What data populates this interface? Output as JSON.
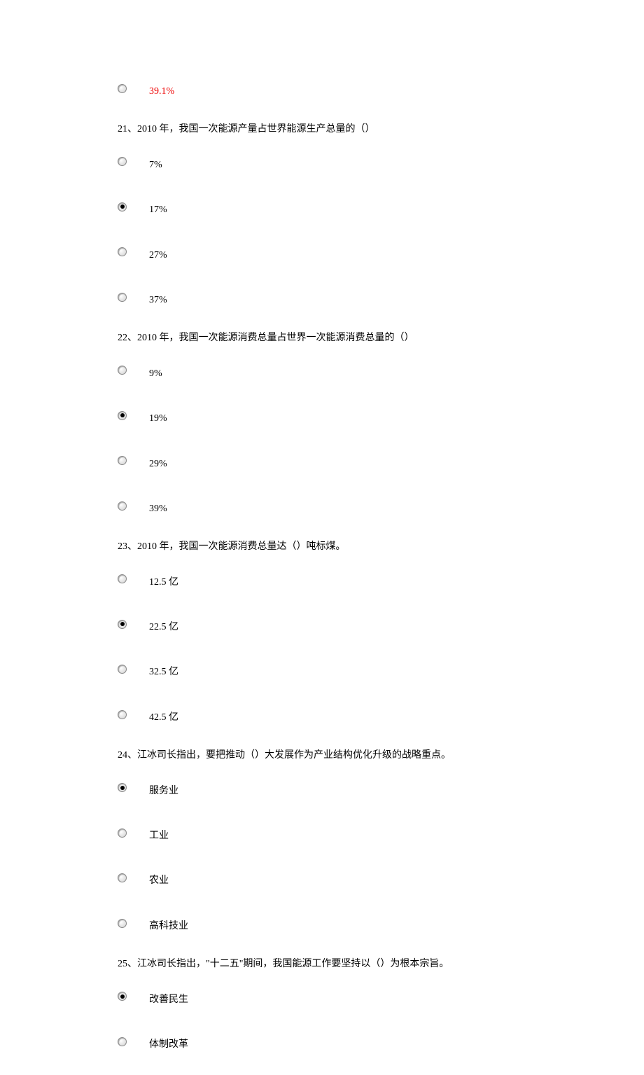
{
  "top_option": {
    "text": "39.1%",
    "highlight": true,
    "selected": false
  },
  "questions": [
    {
      "number": "21",
      "text": "21、2010 年，我国一次能源产量占世界能源生产总量的（）",
      "options": [
        {
          "text": "7%",
          "selected": false
        },
        {
          "text": "17%",
          "selected": true
        },
        {
          "text": "27%",
          "selected": false
        },
        {
          "text": "37%",
          "selected": false
        }
      ]
    },
    {
      "number": "22",
      "text": "22、2010 年，我国一次能源消费总量占世界一次能源消费总量的（）",
      "options": [
        {
          "text": "9%",
          "selected": false
        },
        {
          "text": "19%",
          "selected": true
        },
        {
          "text": "29%",
          "selected": false
        },
        {
          "text": "39%",
          "selected": false
        }
      ]
    },
    {
      "number": "23",
      "text": "23、2010 年，我国一次能源消费总量达（）吨标煤。",
      "options": [
        {
          "text": "12.5 亿",
          "selected": false
        },
        {
          "text": "22.5 亿",
          "selected": true
        },
        {
          "text": "32.5 亿",
          "selected": false
        },
        {
          "text": "42.5 亿",
          "selected": false
        }
      ]
    },
    {
      "number": "24",
      "text": "24、江冰司长指出，要把推动（）大发展作为产业结构优化升级的战略重点。",
      "options": [
        {
          "text": "服务业",
          "selected": true
        },
        {
          "text": "工业",
          "selected": false
        },
        {
          "text": "农业",
          "selected": false
        },
        {
          "text": "高科技业",
          "selected": false
        }
      ]
    },
    {
      "number": "25",
      "text": "25、江冰司长指出，\"十二五\"期间，我国能源工作要坚持以（）为根本宗旨。",
      "options": [
        {
          "text": "改善民生",
          "selected": true
        },
        {
          "text": "体制改革",
          "selected": false
        }
      ]
    }
  ]
}
